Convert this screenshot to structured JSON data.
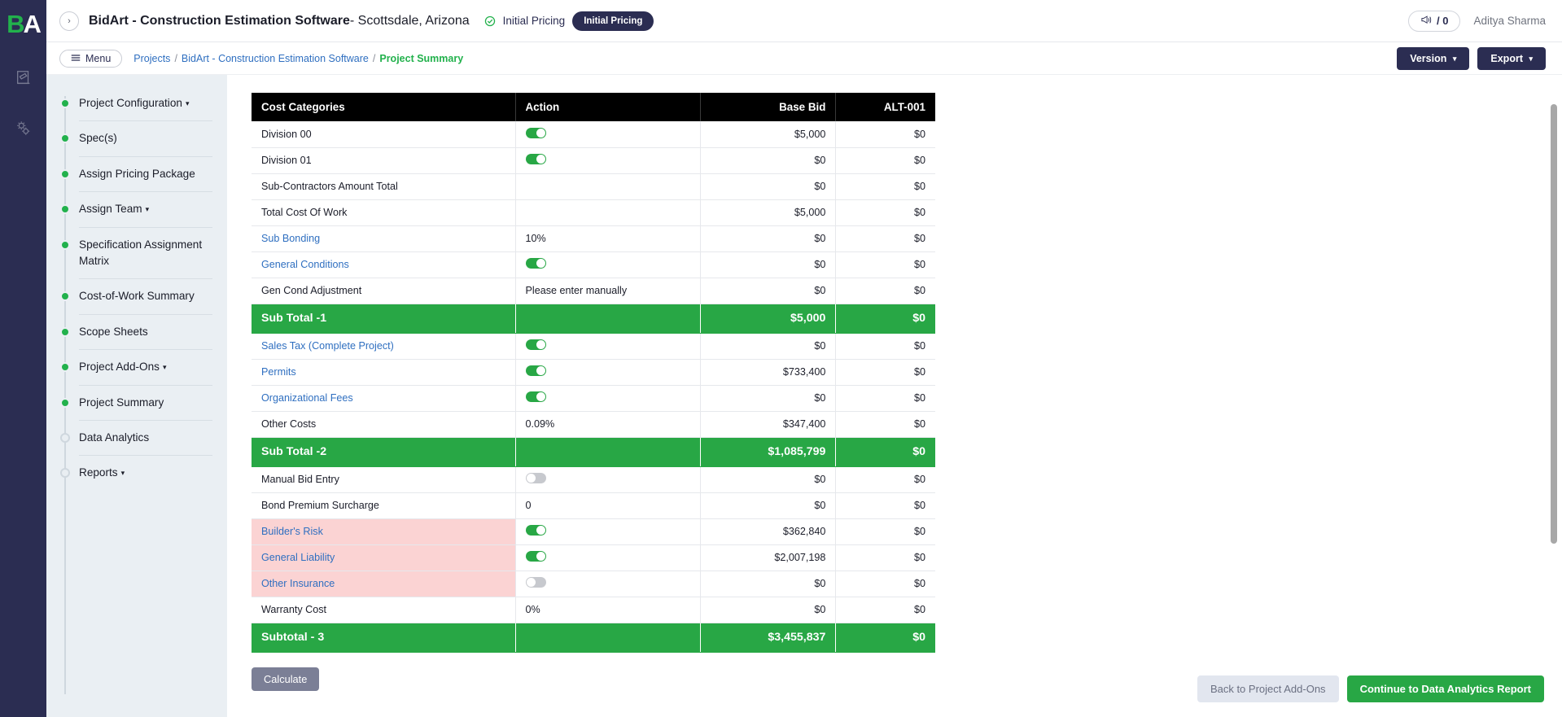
{
  "rail": {
    "logo_b": "B",
    "logo_a": "A",
    "icons": [
      {
        "name": "document-edit-icon"
      },
      {
        "name": "gears-icon"
      }
    ]
  },
  "header": {
    "back_arrow": "›",
    "project_name": "BidArt - Construction Estimation Software",
    "project_location": "- Scottsdale, Arizona",
    "status_check_icon": "✓",
    "status_text": "Initial Pricing",
    "status_badge": "Initial Pricing",
    "notification_icon": "megaphone-icon",
    "notification_count": "/ 0",
    "user_name": "Aditya Sharma"
  },
  "crumbbar": {
    "menu_label": "Menu",
    "menu_icon": "hamburger-icon",
    "crumbs": [
      {
        "label": "Projects",
        "current": false
      },
      {
        "label": "BidArt - Construction Estimation Software",
        "current": false
      },
      {
        "label": "Project Summary",
        "current": true
      }
    ],
    "separator": "/",
    "version_label": "Version",
    "export_label": "Export",
    "caret": "▾"
  },
  "sidebar": {
    "items": [
      {
        "label": "Project Configuration",
        "caret": true,
        "active": true
      },
      {
        "label": "Spec(s)",
        "caret": false,
        "active": true
      },
      {
        "label": "Assign Pricing Package",
        "caret": false,
        "active": true
      },
      {
        "label": "Assign Team",
        "caret": true,
        "active": true
      },
      {
        "label": "Specification Assignment Matrix",
        "caret": false,
        "active": true
      },
      {
        "label": "Cost-of-Work Summary",
        "caret": false,
        "active": true
      },
      {
        "label": "Scope Sheets",
        "caret": false,
        "active": true
      },
      {
        "label": "Project Add-Ons",
        "caret": true,
        "active": true
      },
      {
        "label": "Project Summary",
        "caret": false,
        "active": true
      },
      {
        "label": "Data Analytics",
        "caret": false,
        "active": false
      },
      {
        "label": "Reports",
        "caret": true,
        "active": false
      }
    ]
  },
  "table": {
    "columns": [
      "Cost Categories",
      "Action",
      "Base Bid",
      "ALT-001"
    ],
    "rows": [
      {
        "category": "Division 00",
        "link": false,
        "pink": false,
        "action": {
          "type": "toggle",
          "on": true
        },
        "base_bid": "$5,000",
        "alt_001": "$0"
      },
      {
        "category": "Division 01",
        "link": false,
        "pink": false,
        "action": {
          "type": "toggle",
          "on": true
        },
        "base_bid": "$0",
        "alt_001": "$0"
      },
      {
        "category": "Sub-Contractors Amount Total",
        "link": false,
        "pink": false,
        "action": {
          "type": "none"
        },
        "base_bid": "$0",
        "alt_001": "$0"
      },
      {
        "category": "Total Cost Of Work",
        "link": false,
        "pink": false,
        "action": {
          "type": "none"
        },
        "base_bid": "$5,000",
        "alt_001": "$0"
      },
      {
        "category": "Sub Bonding",
        "link": true,
        "pink": false,
        "action": {
          "type": "text",
          "value": "10%"
        },
        "base_bid": "$0",
        "alt_001": "$0"
      },
      {
        "category": "General Conditions",
        "link": true,
        "pink": false,
        "action": {
          "type": "toggle",
          "on": true
        },
        "base_bid": "$0",
        "alt_001": "$0"
      },
      {
        "category": "Gen Cond Adjustment",
        "link": false,
        "pink": false,
        "action": {
          "type": "placeholder",
          "value": "Please enter manually"
        },
        "base_bid": "$0",
        "alt_001": "$0"
      },
      {
        "category": "Sub Total -1",
        "total": true,
        "base_bid": "$5,000",
        "alt_001": "$0"
      },
      {
        "category": "Sales Tax (Complete Project)",
        "link": true,
        "pink": false,
        "action": {
          "type": "toggle",
          "on": true
        },
        "base_bid": "$0",
        "alt_001": "$0"
      },
      {
        "category": "Permits",
        "link": true,
        "pink": false,
        "action": {
          "type": "toggle",
          "on": true
        },
        "base_bid": "$733,400",
        "alt_001": "$0"
      },
      {
        "category": "Organizational Fees",
        "link": true,
        "pink": false,
        "action": {
          "type": "toggle",
          "on": true
        },
        "base_bid": "$0",
        "alt_001": "$0"
      },
      {
        "category": "Other Costs",
        "link": false,
        "pink": false,
        "action": {
          "type": "text",
          "value": "0.09%"
        },
        "base_bid": "$347,400",
        "alt_001": "$0"
      },
      {
        "category": "Sub Total -2",
        "total": true,
        "base_bid": "$1,085,799",
        "alt_001": "$0"
      },
      {
        "category": "Manual Bid Entry",
        "link": false,
        "pink": false,
        "action": {
          "type": "toggle",
          "on": false
        },
        "base_bid": "$0",
        "alt_001": "$0"
      },
      {
        "category": "Bond Premium Surcharge",
        "link": false,
        "pink": false,
        "action": {
          "type": "text",
          "value": "0"
        },
        "base_bid": "$0",
        "alt_001": "$0"
      },
      {
        "category": "Builder's Risk",
        "link": true,
        "pink": true,
        "action": {
          "type": "toggle",
          "on": true
        },
        "base_bid": "$362,840",
        "alt_001": "$0"
      },
      {
        "category": "General Liability",
        "link": true,
        "pink": true,
        "action": {
          "type": "toggle",
          "on": true
        },
        "base_bid": "$2,007,198",
        "alt_001": "$0"
      },
      {
        "category": "Other Insurance",
        "link": true,
        "pink": true,
        "action": {
          "type": "toggle",
          "on": false
        },
        "base_bid": "$0",
        "alt_001": "$0"
      },
      {
        "category": "Warranty Cost",
        "link": false,
        "pink": false,
        "action": {
          "type": "text",
          "value": "0%"
        },
        "base_bid": "$0",
        "alt_001": "$0"
      },
      {
        "category": "Subtotal - 3",
        "total": true,
        "base_bid": "$3,455,837",
        "alt_001": "$0"
      }
    ]
  },
  "actions": {
    "calculate_label": "Calculate",
    "back_label": "Back to Project Add-Ons",
    "continue_label": "Continue to Data Analytics Report"
  },
  "colors": {
    "brand_navy": "#2b2d52",
    "accent_green": "#28a745",
    "link_blue": "#2f6fc0",
    "pink_row": "#fbd3d3",
    "header_black": "#000000"
  }
}
